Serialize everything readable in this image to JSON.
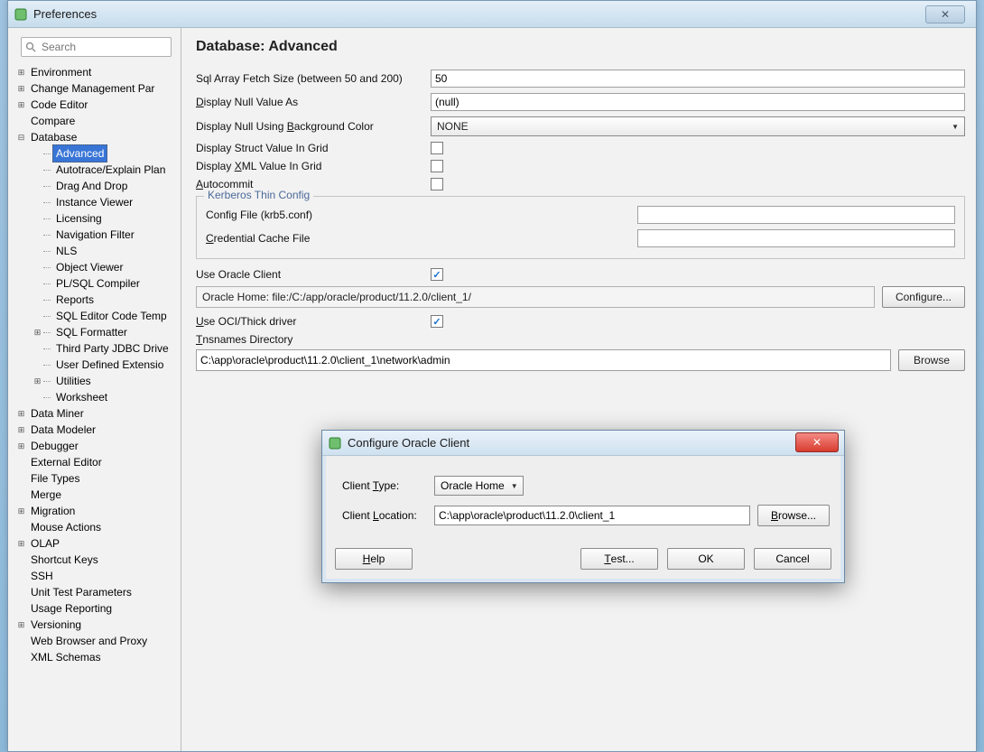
{
  "window": {
    "title": "Preferences",
    "close_glyph": "✕"
  },
  "search": {
    "placeholder": "Search"
  },
  "tree": [
    {
      "indent": 0,
      "toggle": "+",
      "label": "Environment"
    },
    {
      "indent": 0,
      "toggle": "+",
      "label": "Change Management Par"
    },
    {
      "indent": 0,
      "toggle": "+",
      "label": "Code Editor"
    },
    {
      "indent": 0,
      "toggle": "",
      "label": "Compare"
    },
    {
      "indent": 0,
      "toggle": "-",
      "label": "Database"
    },
    {
      "indent": 1,
      "toggle": "",
      "label": "Advanced",
      "selected": true
    },
    {
      "indent": 1,
      "toggle": "",
      "label": "Autotrace/Explain Plan"
    },
    {
      "indent": 1,
      "toggle": "",
      "label": "Drag And Drop"
    },
    {
      "indent": 1,
      "toggle": "",
      "label": "Instance Viewer"
    },
    {
      "indent": 1,
      "toggle": "",
      "label": "Licensing"
    },
    {
      "indent": 1,
      "toggle": "",
      "label": "Navigation Filter"
    },
    {
      "indent": 1,
      "toggle": "",
      "label": "NLS"
    },
    {
      "indent": 1,
      "toggle": "",
      "label": "Object Viewer"
    },
    {
      "indent": 1,
      "toggle": "",
      "label": "PL/SQL Compiler"
    },
    {
      "indent": 1,
      "toggle": "",
      "label": "Reports"
    },
    {
      "indent": 1,
      "toggle": "",
      "label": "SQL Editor Code Temp"
    },
    {
      "indent": 1,
      "toggle": "+",
      "label": "SQL Formatter"
    },
    {
      "indent": 1,
      "toggle": "",
      "label": "Third Party JDBC Drive"
    },
    {
      "indent": 1,
      "toggle": "",
      "label": "User Defined Extensio"
    },
    {
      "indent": 1,
      "toggle": "+",
      "label": "Utilities"
    },
    {
      "indent": 1,
      "toggle": "",
      "label": "Worksheet"
    },
    {
      "indent": 0,
      "toggle": "+",
      "label": "Data Miner"
    },
    {
      "indent": 0,
      "toggle": "+",
      "label": "Data Modeler"
    },
    {
      "indent": 0,
      "toggle": "+",
      "label": "Debugger"
    },
    {
      "indent": 0,
      "toggle": "",
      "label": "External Editor"
    },
    {
      "indent": 0,
      "toggle": "",
      "label": "File Types"
    },
    {
      "indent": 0,
      "toggle": "",
      "label": "Merge"
    },
    {
      "indent": 0,
      "toggle": "+",
      "label": "Migration"
    },
    {
      "indent": 0,
      "toggle": "",
      "label": "Mouse Actions"
    },
    {
      "indent": 0,
      "toggle": "+",
      "label": "OLAP"
    },
    {
      "indent": 0,
      "toggle": "",
      "label": "Shortcut Keys"
    },
    {
      "indent": 0,
      "toggle": "",
      "label": "SSH"
    },
    {
      "indent": 0,
      "toggle": "",
      "label": "Unit Test Parameters"
    },
    {
      "indent": 0,
      "toggle": "",
      "label": "Usage Reporting"
    },
    {
      "indent": 0,
      "toggle": "+",
      "label": "Versioning"
    },
    {
      "indent": 0,
      "toggle": "",
      "label": "Web Browser and Proxy"
    },
    {
      "indent": 0,
      "toggle": "",
      "label": "XML Schemas"
    }
  ],
  "content": {
    "heading": "Database: Advanced",
    "sql_fetch_label": "Sql Array Fetch Size (between 50 and 200)",
    "sql_fetch_value": "50",
    "null_value_label_pre": "D",
    "null_value_label_post": "isplay Null Value As",
    "null_value_value": "(null)",
    "null_bg_label_pre": "Display Null Using ",
    "null_bg_label_u": "B",
    "null_bg_label_post": "ackground Color",
    "null_bg_value": "NONE",
    "struct_label": "Display Struct Value In Grid",
    "xml_label_pre": "Display ",
    "xml_label_u": "X",
    "xml_label_post": "ML Value In Grid",
    "autocommit_label_u": "A",
    "autocommit_label_post": "utocommit",
    "kerberos_legend": "Kerberos Thin Config",
    "kerberos_file_label": "Config File (krb5.conf)",
    "kerberos_file_value": "",
    "kerberos_cache_label_u": "C",
    "kerberos_cache_label_post": "redential Cache File",
    "kerberos_cache_value": "",
    "use_oracle_label": "Use Oracle Client",
    "oracle_home_text": "Oracle Home: file:/C:/app/oracle/product/11.2.0/client_1/",
    "configure_label": "Configure...",
    "use_oci_label_u": "U",
    "use_oci_label_post": "se OCI/Thick driver",
    "tns_label_u": "T",
    "tns_label_post": "nsnames Directory",
    "tns_value": "C:\\app\\oracle\\product\\11.2.0\\client_1\\network\\admin",
    "browse_label": "Browse"
  },
  "modal": {
    "title": "Configure Oracle Client",
    "close_glyph": "✕",
    "client_type_label_pre": "Client ",
    "client_type_label_u": "T",
    "client_type_label_post": "ype:",
    "client_type_value": "Oracle Home",
    "client_loc_label_pre": "Client ",
    "client_loc_label_u": "L",
    "client_loc_label_post": "ocation:",
    "client_loc_value": "C:\\app\\oracle\\product\\11.2.0\\client_1",
    "browse_label_u": "B",
    "browse_label_post": "rowse...",
    "help_label_u": "H",
    "help_label_post": "elp",
    "test_label_u": "T",
    "test_label_post": "est...",
    "ok_label": "OK",
    "cancel_label": "Cancel"
  }
}
